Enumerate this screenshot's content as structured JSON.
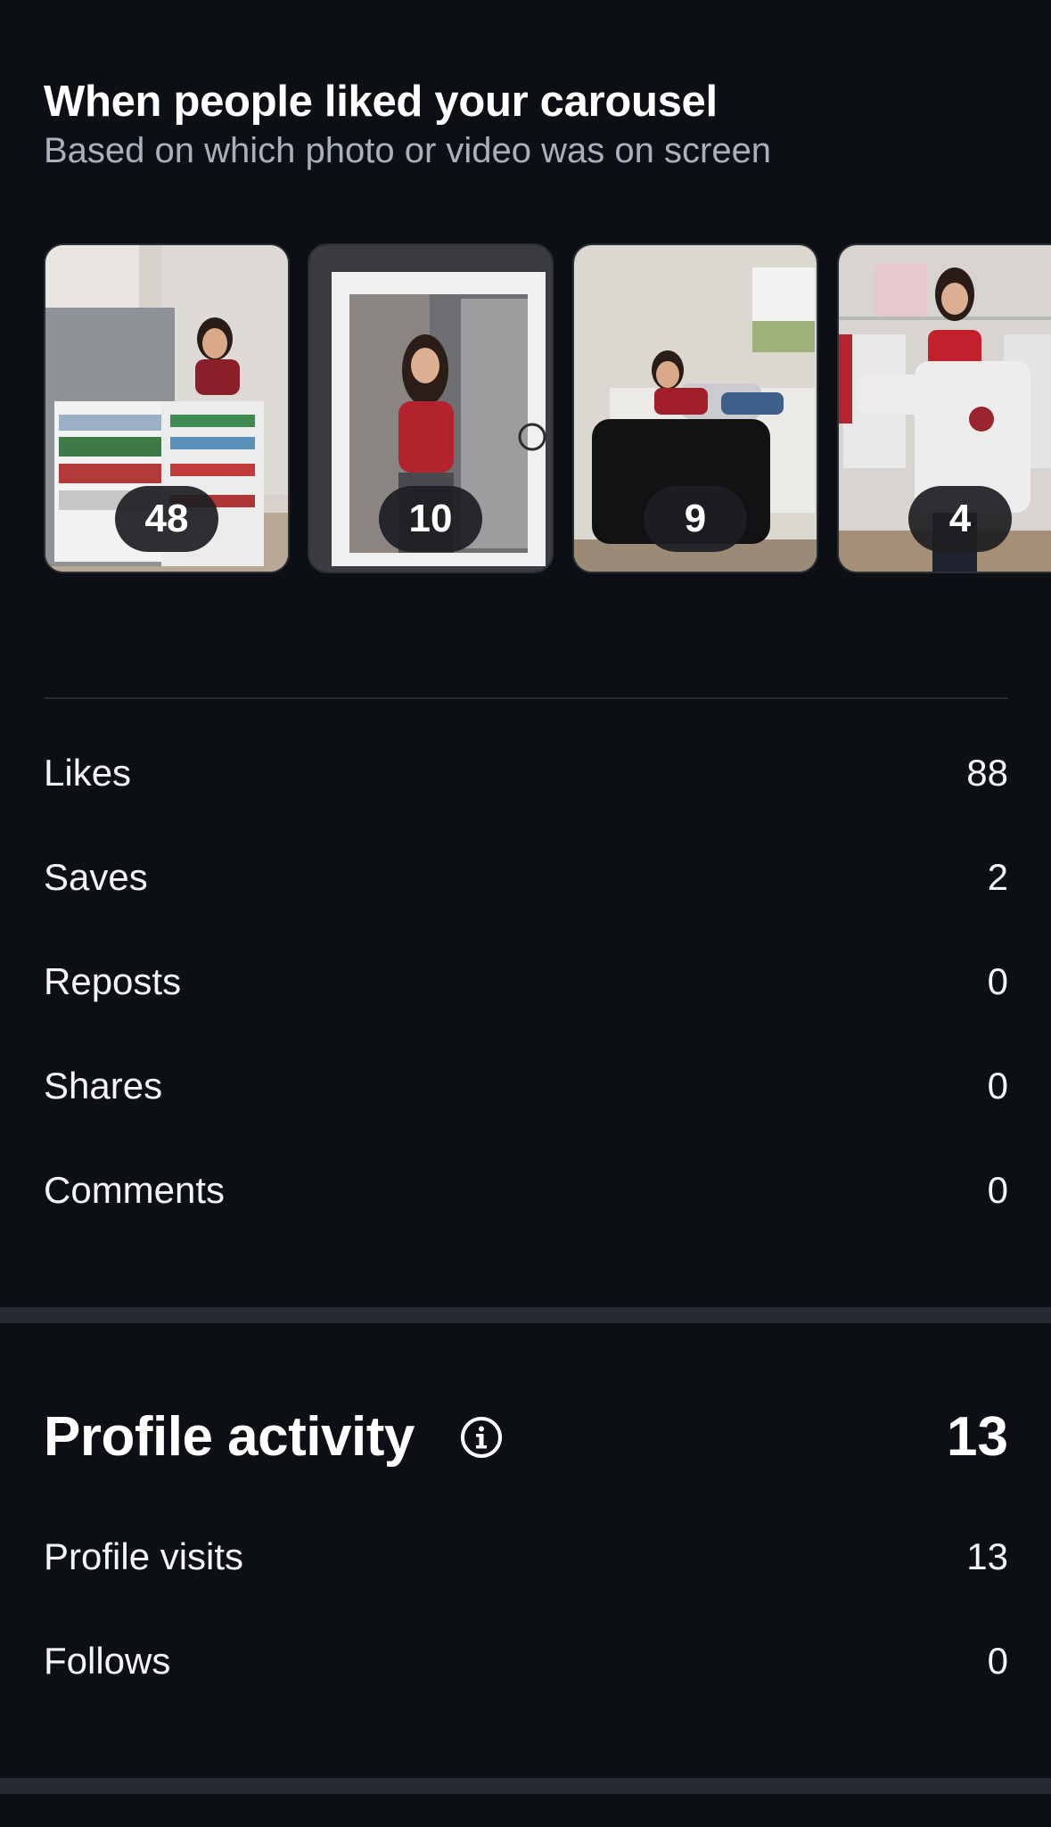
{
  "carousel_section": {
    "title": "When people liked your carousel",
    "subtitle": "Based on which photo or video was on screen",
    "slides": [
      {
        "count": "48",
        "photo": "woman-with-open-fridge"
      },
      {
        "count": "10",
        "photo": "woman-in-lighted-mirror"
      },
      {
        "count": "9",
        "photo": "woman-lying-on-bed"
      },
      {
        "count": "4",
        "photo": "woman-holding-sweatshirt"
      }
    ]
  },
  "engagement": [
    {
      "label": "Likes",
      "value": "88"
    },
    {
      "label": "Saves",
      "value": "2"
    },
    {
      "label": "Reposts",
      "value": "0"
    },
    {
      "label": "Shares",
      "value": "0"
    },
    {
      "label": "Comments",
      "value": "0"
    }
  ],
  "profile_activity": {
    "title": "Profile activity",
    "total": "13",
    "icon": "info-icon",
    "rows": [
      {
        "label": "Profile visits",
        "value": "13"
      },
      {
        "label": "Follows",
        "value": "0"
      }
    ]
  },
  "colors": {
    "background": "#0c1014",
    "subtitle": "#a8b0bb",
    "divider": "#262b31",
    "pill": "#1c1e22"
  }
}
